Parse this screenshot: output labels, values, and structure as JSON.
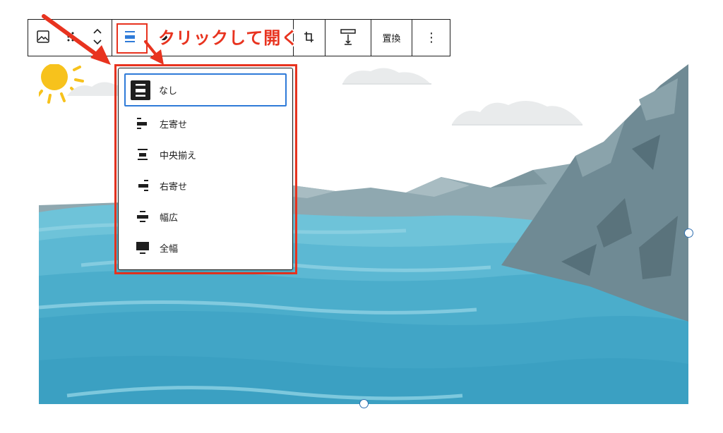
{
  "toolbar": {
    "buttons": [
      {
        "name": "image-icon"
      },
      {
        "name": "drag-handle-icon"
      },
      {
        "name": "move-up-down-icon"
      },
      {
        "name": "align-center-icon"
      },
      {
        "name": "text-overlay-icon"
      },
      {
        "name": "crop-icon"
      },
      {
        "name": "caption-icon"
      }
    ],
    "replace_label": "置換",
    "more_label": "⋮"
  },
  "annotation": {
    "callout_text": "クリックして開く",
    "color": "#e8331f"
  },
  "alignment_menu": {
    "items": [
      {
        "label": "なし",
        "icon": "align-none-icon",
        "selected": true
      },
      {
        "label": "左寄せ",
        "icon": "align-left-icon",
        "selected": false
      },
      {
        "label": "中央揃え",
        "icon": "align-center-icon",
        "selected": false
      },
      {
        "label": "右寄せ",
        "icon": "align-right-icon",
        "selected": false
      },
      {
        "label": "幅広",
        "icon": "align-wide-icon",
        "selected": false
      },
      {
        "label": "全幅",
        "icon": "align-full-icon",
        "selected": false
      }
    ],
    "focus_color": "#2f7bd8"
  },
  "image": {
    "colors": {
      "sky": "#ffffff",
      "sea": "#4bb1d0",
      "mountain": "#6f8a94",
      "sun": "#f7c21c"
    }
  }
}
